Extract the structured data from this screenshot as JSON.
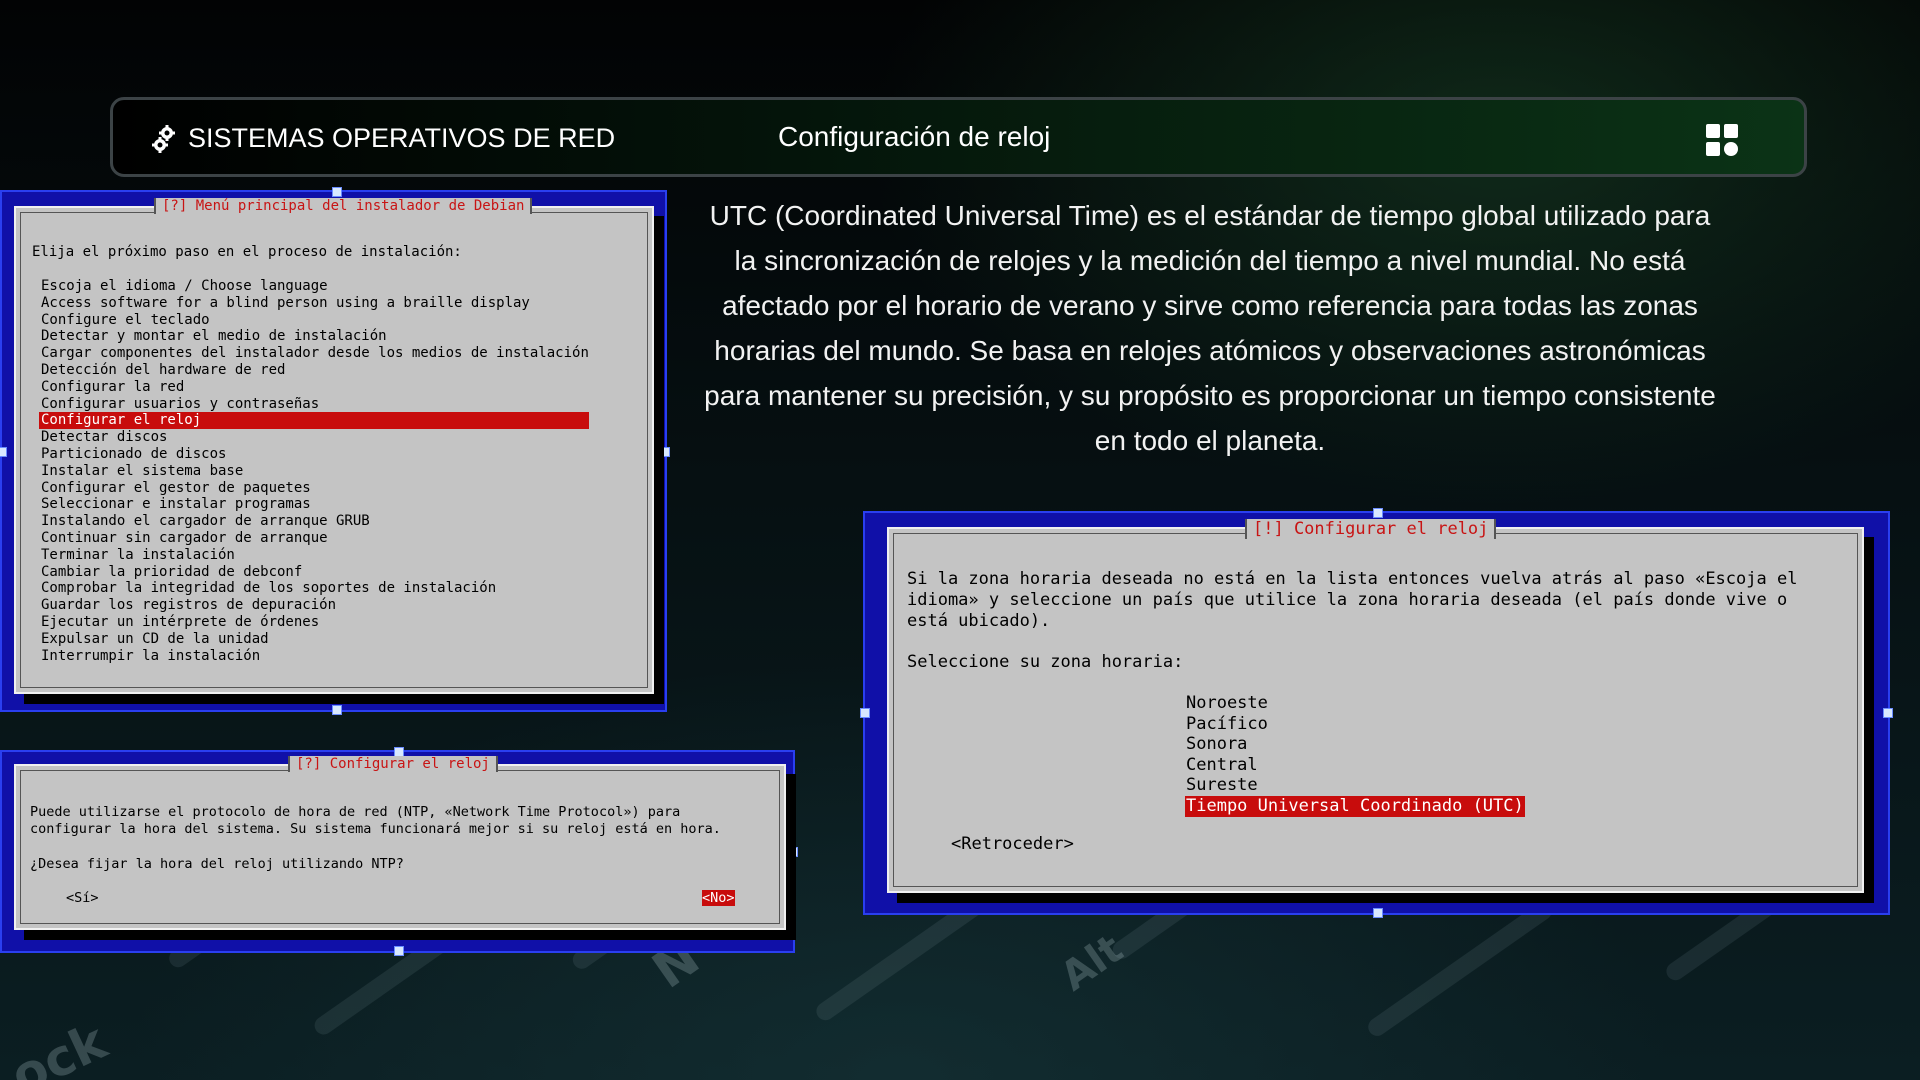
{
  "header": {
    "brand": "SISTEMAS OPERATIVOS DE RED",
    "topic": "Configuración de reloj",
    "logo_icon": "gears-icon",
    "menu_icon": "grid-menu-icon"
  },
  "description": "UTC (Coordinated Universal Time) es el estándar de tiempo global utilizado para la sincronización de relojes y la medición del tiempo a nivel mundial. No está afectado por el horario de verano y sirve como referencia para todas las zonas horarias del mundo. Se basa en relojes atómicos y observaciones astronómicas para mantener su precisión, y su propósito es proporcionar un tiempo consistente en todo el planeta.",
  "installer_menu": {
    "title": "[?] Menú principal del instalador de Debian",
    "prompt": "Elija el próximo paso en el proceso de instalación:",
    "items": [
      "Escoja el idioma / Choose language",
      "Access software for a blind person using a braille display",
      "Configure el teclado",
      "Detectar y montar el medio de instalación",
      "Cargar componentes del instalador desde los medios de instalación",
      "Detección del hardware de red",
      "Configurar la red",
      "Configurar usuarios y contraseñas",
      "Configurar el reloj",
      "Detectar discos",
      "Particionado de discos",
      "Instalar el sistema base",
      "Configurar el gestor de paquetes",
      "Seleccionar e instalar programas",
      "Instalando el cargador de arranque GRUB",
      "Continuar sin cargador de arranque",
      "Terminar la instalación",
      "Cambiar la prioridad de debconf",
      "Comprobar la integridad de los soportes de instalación",
      "Guardar los registros de depuración",
      "Ejecutar un intérprete de órdenes",
      "Expulsar un CD de la unidad",
      "Interrumpir la instalación"
    ],
    "selected_index": 8
  },
  "ntp_dialog": {
    "title": "[?] Configurar el reloj",
    "text_line1": "Puede utilizarse el protocolo de hora de red (NTP, «Network Time Protocol») para",
    "text_line2": "configurar la hora del sistema. Su sistema funcionará mejor si su reloj está en hora.",
    "question": "¿Desea fijar la hora del reloj utilizando NTP?",
    "yes": "<Sí>",
    "no": "<No>",
    "selected": "no"
  },
  "tz_dialog": {
    "title": "[!] Configurar el reloj",
    "text_line1": "Si la zona horaria deseada no está en la lista entonces vuelva atrás al paso «Escoja el",
    "text_line2": "idioma» y seleccione un país que utilice la zona horaria deseada (el país donde vive o",
    "text_line3": "está ubicado).",
    "prompt": "Seleccione su zona horaria:",
    "options": [
      "Noroeste",
      "Pacífico",
      "Sonora",
      "Central",
      "Sureste",
      "Tiempo Universal Coordinado (UTC)"
    ],
    "selected_index": 5,
    "back": "<Retroceder>"
  },
  "keyboard_keys": [
    "Alt",
    "N",
    "ock"
  ]
}
